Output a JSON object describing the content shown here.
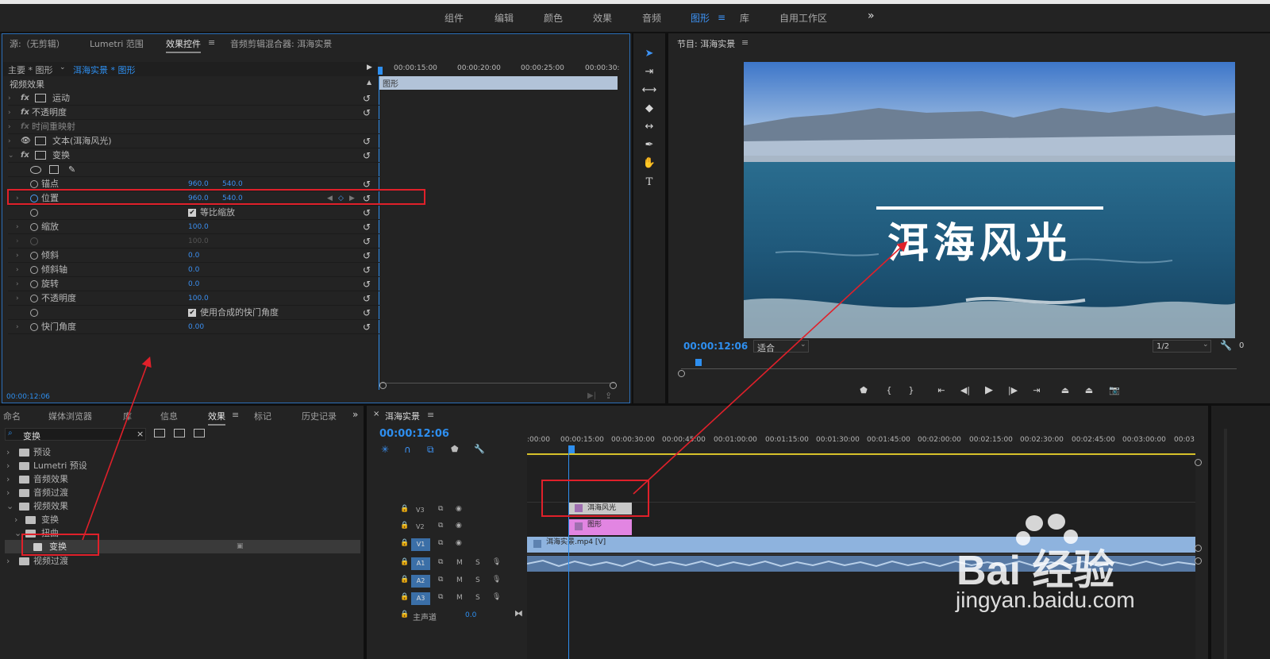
{
  "workspace": {
    "tabs": [
      "组件",
      "编辑",
      "颜色",
      "效果",
      "音频",
      "图形",
      "库",
      "自用工作区"
    ],
    "active_tab": "图形",
    "overflow": "»"
  },
  "source_panel": {
    "tabs": [
      "源:（无剪辑）",
      "Lumetri 范围",
      "效果控件",
      "音频剪辑混合器: 洱海实景"
    ],
    "active_tab": "效果控件",
    "master": "主要 * 图形",
    "clip": "洱海实景 * 图形",
    "ruler": [
      "00:00:15:00",
      "00:00:20:00",
      "00:00:25:00",
      "00:00:30:"
    ],
    "graphic_bar": "图形",
    "section": "视频效果",
    "rows": [
      {
        "label": "运动",
        "fx": true,
        "icon": "transform-icon"
      },
      {
        "label": "不透明度",
        "fx": true
      },
      {
        "label": "时间重映射",
        "fx": true,
        "dim": true
      },
      {
        "label": "文本(洱海风光)",
        "eye": true,
        "icon": "transform-icon"
      },
      {
        "label": "变换",
        "fx": true,
        "icon": "transform-icon"
      }
    ],
    "props": {
      "anchor": {
        "label": "锚点",
        "x": "960.0",
        "y": "540.0"
      },
      "position": {
        "label": "位置",
        "x": "960.0",
        "y": "540.0"
      },
      "uniform": {
        "label": "等比缩放"
      },
      "scale": {
        "label": "缩放",
        "value": "100.0"
      },
      "scale_w": {
        "value": "100.0"
      },
      "skew": {
        "label": "倾斜",
        "value": "0.0"
      },
      "skew_axis": {
        "label": "倾斜轴",
        "value": "0.0"
      },
      "rotation": {
        "label": "旋转",
        "value": "0.0"
      },
      "opacity": {
        "label": "不透明度",
        "value": "100.0"
      },
      "shutter_comp": {
        "label": "使用合成的快门角度"
      },
      "shutter": {
        "label": "快门角度",
        "value": "0.00"
      }
    },
    "timecode": "00:00:12:06"
  },
  "program": {
    "title": "节目: 洱海实景",
    "overlay_text": "洱海风光",
    "timecode": "00:00:12:06",
    "fit": "适合",
    "resolution": "1/2",
    "overflow": "0"
  },
  "effects_panel": {
    "tabs": [
      "命名",
      "媒体浏览器",
      "库",
      "信息",
      "效果",
      "标记",
      "历史记录"
    ],
    "active_tab": "效果",
    "search_value": "变换",
    "tree": [
      {
        "label": "预设",
        "level": 0
      },
      {
        "label": "Lumetri 预设",
        "level": 0
      },
      {
        "label": "音频效果",
        "level": 0
      },
      {
        "label": "音频过渡",
        "level": 0
      },
      {
        "label": "视频效果",
        "level": 0,
        "open": true
      },
      {
        "label": "变换",
        "level": 1
      },
      {
        "label": "扭曲",
        "level": 1,
        "open": true
      },
      {
        "label": "变换",
        "level": 2,
        "selected": true
      },
      {
        "label": "视频过渡",
        "level": 0
      }
    ]
  },
  "timeline": {
    "title": "洱海实景",
    "timecode": "00:00:12:06",
    "ruler": [
      ":00:00",
      "00:00:15:00",
      "00:00:30:00",
      "00:00:45:00",
      "00:01:00:00",
      "00:01:15:00",
      "00:01:30:00",
      "00:01:45:00",
      "00:02:00:00",
      "00:02:15:00",
      "00:02:30:00",
      "00:02:45:00",
      "00:03:00:00",
      "00:03"
    ],
    "tracks_video": [
      "V3",
      "V2",
      "V1"
    ],
    "tracks_audio": [
      "A1",
      "A2",
      "A3"
    ],
    "master": "主声道",
    "master_value": "0.0",
    "clips": {
      "v3": "洱海风光",
      "v2": "图形",
      "v1": "洱海实景.mp4 [V]"
    },
    "mute": "M",
    "solo": "S"
  },
  "watermark": {
    "line1": "Bai 经验",
    "line2": "jingyan.baidu.com"
  },
  "colors": {
    "accent": "#2e8ff0",
    "highlight_red": "#e0202a",
    "graphic_clip": "#e285e2",
    "text_clip": "#c8c8c8",
    "video_clip": "#8eb3de"
  }
}
